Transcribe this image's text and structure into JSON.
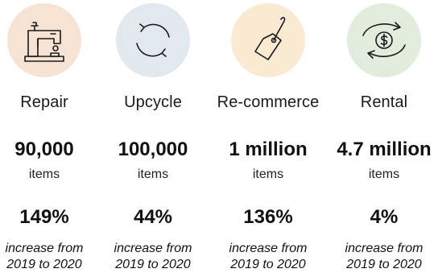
{
  "columns": [
    {
      "icon": "sewing-machine-icon",
      "icon_bg": "#f7e3d4",
      "label": "Repair",
      "count": "90,000",
      "unit": "items",
      "percent": "149%",
      "desc_line1": "increase from",
      "desc_line2": "2019 to 2020"
    },
    {
      "icon": "refresh-cycle-icon",
      "icon_bg": "#e1e8ee",
      "label": "Upcycle",
      "count": "100,000",
      "unit": "items",
      "percent": "44%",
      "desc_line1": "increase from",
      "desc_line2": "2019 to 2020"
    },
    {
      "icon": "price-tag-icon",
      "icon_bg": "#fbead2",
      "label": "Re-commerce",
      "count": "1 million",
      "unit": "items",
      "percent": "136%",
      "desc_line1": "increase from",
      "desc_line2": "2019 to 2020"
    },
    {
      "icon": "dollar-exchange-icon",
      "icon_bg": "#e1ecdd",
      "label": "Rental",
      "count": "4.7 million",
      "unit": "items",
      "percent": "4%",
      "desc_line1": "increase from",
      "desc_line2": "2019 to 2020"
    }
  ]
}
